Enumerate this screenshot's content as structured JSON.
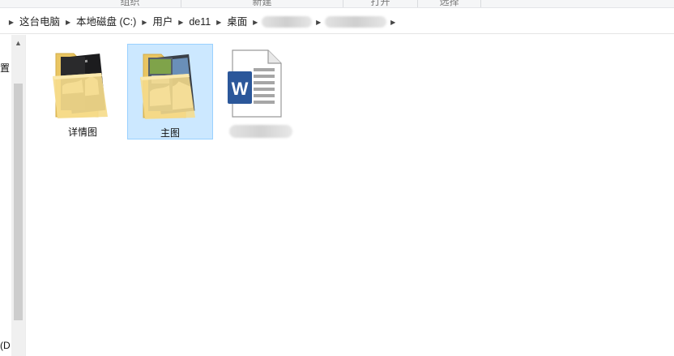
{
  "ribbon": {
    "groups": [
      "组织",
      "新建",
      "打开",
      "选择"
    ]
  },
  "address": {
    "breadcrumbs": [
      "这台电脑",
      "本地磁盘 (C:)",
      "用户",
      "de11",
      "桌面"
    ]
  },
  "nav": {
    "partial_text_top": "置",
    "partial_text_bottom": "(D"
  },
  "files": [
    {
      "label": "详情图",
      "type": "folder",
      "selected": false
    },
    {
      "label": "主图",
      "type": "folder",
      "selected": true
    },
    {
      "label": "",
      "type": "word-document",
      "selected": false
    }
  ],
  "colors": {
    "selection_fill": "#cce8ff",
    "selection_border": "#99d1ff",
    "word_blue": "#2b579a",
    "folder_yellow": "#f3d37a"
  }
}
